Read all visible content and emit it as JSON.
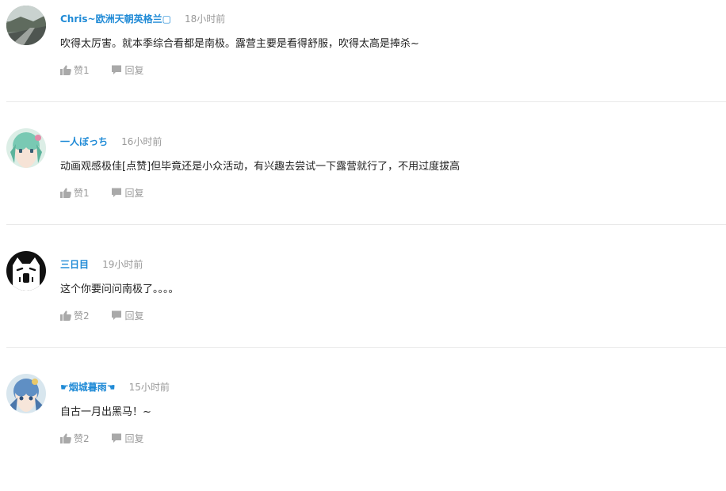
{
  "colors": {
    "username": "#1f8ad6",
    "time": "#999999",
    "action": "#9a9a9a",
    "divider": "#e9e9e9"
  },
  "comments": [
    {
      "username": "Chris~欧洲天朝英格兰▢",
      "time": "18小时前",
      "content": "吹得太厉害。就本季综合看都是南极。露营主要是看得舒服，吹得太高是捧杀~",
      "like_label": "赞1",
      "reply_label": "回复",
      "avatar_icon": "landscape-road-avatar"
    },
    {
      "username": "一人ぼっち",
      "time": "16小时前",
      "content": "动画观感极佳[点赞]但毕竟还是小众活动，有兴趣去尝试一下露营就行了，不用过度拔高",
      "like_label": "赞1",
      "reply_label": "回复",
      "avatar_icon": "anime-girl-avatar"
    },
    {
      "username": "三日目",
      "time": "19小时前",
      "content": "这个你要问问南极了。。。。",
      "like_label": "赞2",
      "reply_label": "回复",
      "avatar_icon": "cartoon-cat-avatar"
    },
    {
      "username": "☛烟城暮雨☚",
      "time": "15小时前",
      "content": "自古一月出黑马！~",
      "like_label": "赞2",
      "reply_label": "回复",
      "avatar_icon": "anime-blue-hair-avatar"
    }
  ]
}
